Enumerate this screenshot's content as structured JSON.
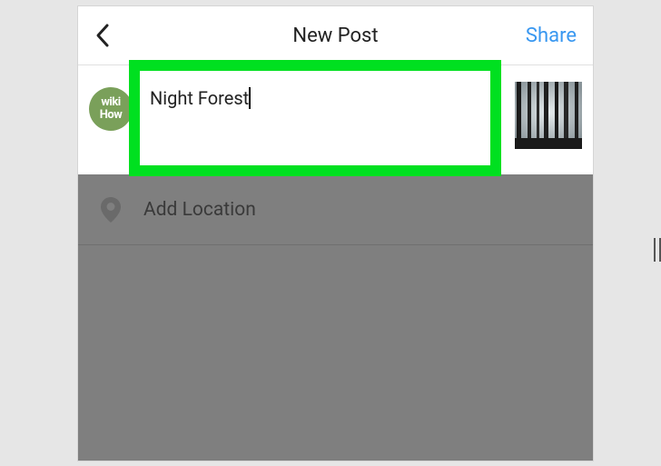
{
  "header": {
    "title": "New Post",
    "share_label": "Share"
  },
  "avatar": {
    "line1": "wiki",
    "line2": "How"
  },
  "caption": {
    "text": "Night Forest"
  },
  "location": {
    "label": "Add Location"
  }
}
